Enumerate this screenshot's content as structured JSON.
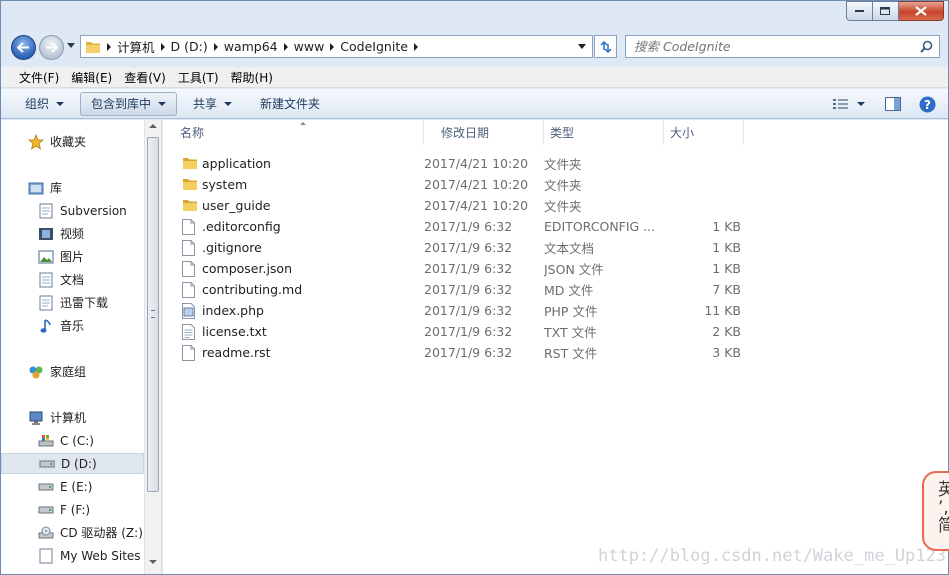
{
  "window": {
    "address": [
      "计算机",
      "D (D:)",
      "wamp64",
      "www",
      "CodeIgnite"
    ],
    "search_placeholder": "搜索 CodeIgnite"
  },
  "menu": [
    "文件(F)",
    "编辑(E)",
    "查看(V)",
    "工具(T)",
    "帮助(H)"
  ],
  "commands": {
    "organize": "组织",
    "include_library": "包含到库中",
    "share": "共享",
    "new_folder": "新建文件夹"
  },
  "nav": {
    "favorites": "收藏夹",
    "libraries": "库",
    "lib_items": [
      "Subversion",
      "视频",
      "图片",
      "文档",
      "迅雷下载",
      "音乐"
    ],
    "homegroup": "家庭组",
    "computer": "计算机",
    "drives": [
      "C (C:)",
      "D (D:)",
      "E (E:)",
      "F (F:)",
      "CD 驱动器 (Z:)",
      "My Web Sites"
    ]
  },
  "columns": [
    "名称",
    "修改日期",
    "类型",
    "大小"
  ],
  "files": [
    {
      "name": "application",
      "date": "2017/4/21 10:20",
      "type": "文件夹",
      "size": "",
      "icon": "folder-icon"
    },
    {
      "name": "system",
      "date": "2017/4/21 10:20",
      "type": "文件夹",
      "size": "",
      "icon": "folder-icon"
    },
    {
      "name": "user_guide",
      "date": "2017/4/21 10:20",
      "type": "文件夹",
      "size": "",
      "icon": "folder-icon"
    },
    {
      "name": ".editorconfig",
      "date": "2017/1/9 6:32",
      "type": "EDITORCONFIG ...",
      "size": "1 KB",
      "icon": "file-icon"
    },
    {
      "name": ".gitignore",
      "date": "2017/1/9 6:32",
      "type": "文本文档",
      "size": "1 KB",
      "icon": "file-icon"
    },
    {
      "name": "composer.json",
      "date": "2017/1/9 6:32",
      "type": "JSON 文件",
      "size": "1 KB",
      "icon": "file-icon"
    },
    {
      "name": "contributing.md",
      "date": "2017/1/9 6:32",
      "type": "MD 文件",
      "size": "7 KB",
      "icon": "file-icon"
    },
    {
      "name": "index.php",
      "date": "2017/1/9 6:32",
      "type": "PHP 文件",
      "size": "11 KB",
      "icon": "php-file-icon"
    },
    {
      "name": "license.txt",
      "date": "2017/1/9 6:32",
      "type": "TXT 文件",
      "size": "2 KB",
      "icon": "text-file-icon"
    },
    {
      "name": "readme.rst",
      "date": "2017/1/9 6:32",
      "type": "RST 文件",
      "size": "3 KB",
      "icon": "file-icon"
    }
  ],
  "watermark": "http://blog.csdn.net/Wake_me_Up123",
  "sticker": "英\n’,\n简"
}
